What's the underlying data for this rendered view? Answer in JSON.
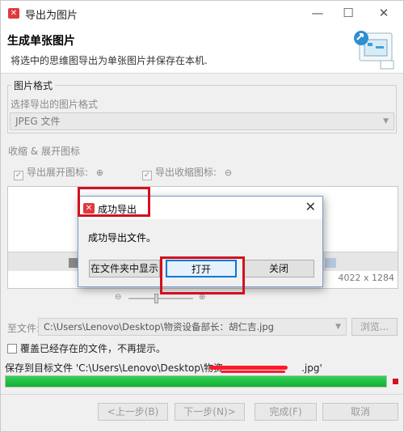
{
  "window": {
    "title": "导出为图片",
    "minimize_icon": "—",
    "maximize_icon": "☐",
    "close_icon": "✕"
  },
  "header": {
    "title": "生成单张图片",
    "description": "将选中的思维图导出为单张图片并保存在本机."
  },
  "format": {
    "group_label": "图片格式",
    "select_prompt": "选择导出的图片格式",
    "selected": "JPEG 文件"
  },
  "collapse": {
    "section_label": "收缩 & 展开图标",
    "expand_label": "导出展开图标:",
    "collapse_label": "导出收缩图标:",
    "expand_symbol": "⊕",
    "collapse_symbol": "⊖"
  },
  "preview": {
    "size_text": "4022 x 1284"
  },
  "save": {
    "label": "至文件:",
    "path": "C:\\Users\\Lenovo\\Desktop\\物资设备部长：胡仁吉.jpg",
    "browse_label": "浏览..."
  },
  "overwrite": {
    "label": "覆盖已经存在的文件，不再提示。"
  },
  "status": {
    "text_prefix": "保存到目标文件 'C:\\Users\\Lenovo\\Desktop\\物资",
    "text_suffix": ".jpg'",
    "progress": 1.0
  },
  "footer": {
    "prev_label": "<上一步(B)",
    "next_label": "下一步(N)>",
    "finish_label": "完成(F)",
    "cancel_label": "取消"
  },
  "dialog": {
    "title": "成功导出",
    "message": "成功导出文件。",
    "show_in_folder_label": "在文件夹中显示",
    "open_label": "打开",
    "close_label": "关闭"
  },
  "colors": {
    "accent_red": "#d4101f",
    "progress_green": "#16b13a",
    "brand_red": "#e03a3e"
  }
}
